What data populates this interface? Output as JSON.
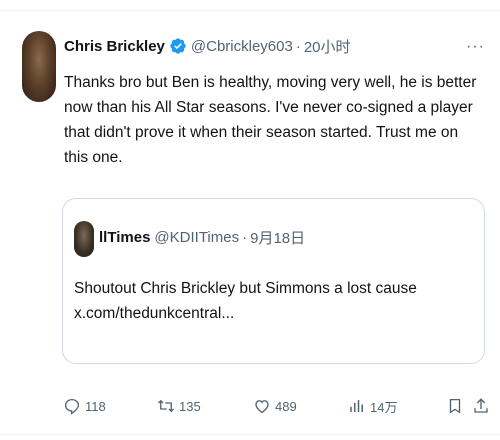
{
  "tweet": {
    "author_name": "Chris Brickley",
    "author_handle": "@Cbrickley603",
    "separator": "·",
    "time": "20小时",
    "more": "···",
    "text": "Thanks bro but Ben is healthy, moving very well, he is better now than his All Star seasons. I've never co-signed a player that didn't prove it when their season started. Trust me on this one."
  },
  "quote": {
    "author_name": "llTimes",
    "author_handle": "@KDIITimes",
    "separator": "·",
    "time": "9月18日",
    "text_line1": "Shoutout Chris Brickley but Simmons a lost cause",
    "text_line2": "x.com/thedunkcentral..."
  },
  "actions": {
    "replies": "118",
    "reposts": "135",
    "likes": "489",
    "views": "14万"
  },
  "colors": {
    "verified": "#1d9bf0",
    "muted": "#536471",
    "text": "#0f1419",
    "border": "#cfd9de"
  },
  "icons": [
    "verified-badge-icon",
    "more-icon",
    "reply-icon",
    "repost-icon",
    "like-icon",
    "views-icon",
    "bookmark-icon",
    "share-icon"
  ]
}
